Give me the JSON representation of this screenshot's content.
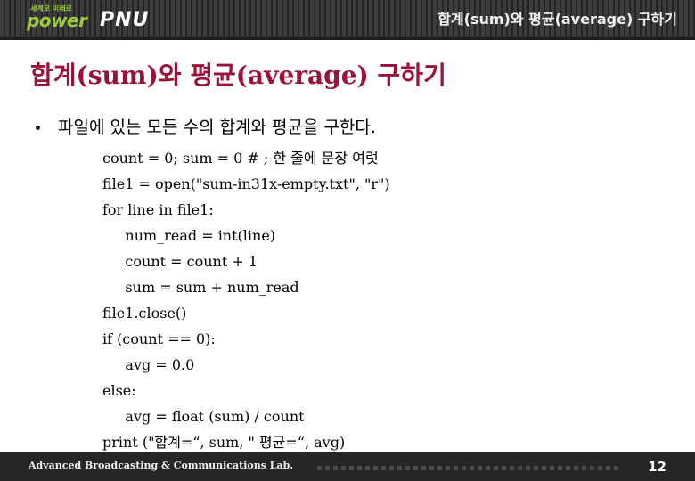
{
  "header": {
    "logo": {
      "korean_tagline": "세계로 미래로",
      "word_power": "power",
      "word_pnu": "PNU"
    },
    "title": "합계(sum)와 평균(average) 구하기"
  },
  "slide": {
    "title": "합계(sum)와 평균(average) 구하기",
    "bullet": "파일에 있는 모든 수의 합계와 평균을 구한다.",
    "code_lines": [
      "count = 0; sum = 0 # ; 한 줄에 문장 여럿",
      "file1 = open(\"sum-in31x-empty.txt\", \"r\")",
      "for line in file1:",
      "     num_read = int(line)",
      "     count = count + 1",
      "     sum = sum + num_read",
      "file1.close()",
      "if (count == 0):",
      "     avg = 0.0",
      "else:",
      "     avg = float (sum) / count",
      "print (\"합계=“, sum, \" 평균=“, avg)"
    ]
  },
  "footer": {
    "lab_name": "Advanced Broadcasting & Communications Lab.",
    "page_number": "12"
  },
  "colors": {
    "header_bg": "#262626",
    "logo_green": "#9bcb3b",
    "title_maroon": "#9b1237",
    "footer_bg": "#262626"
  }
}
